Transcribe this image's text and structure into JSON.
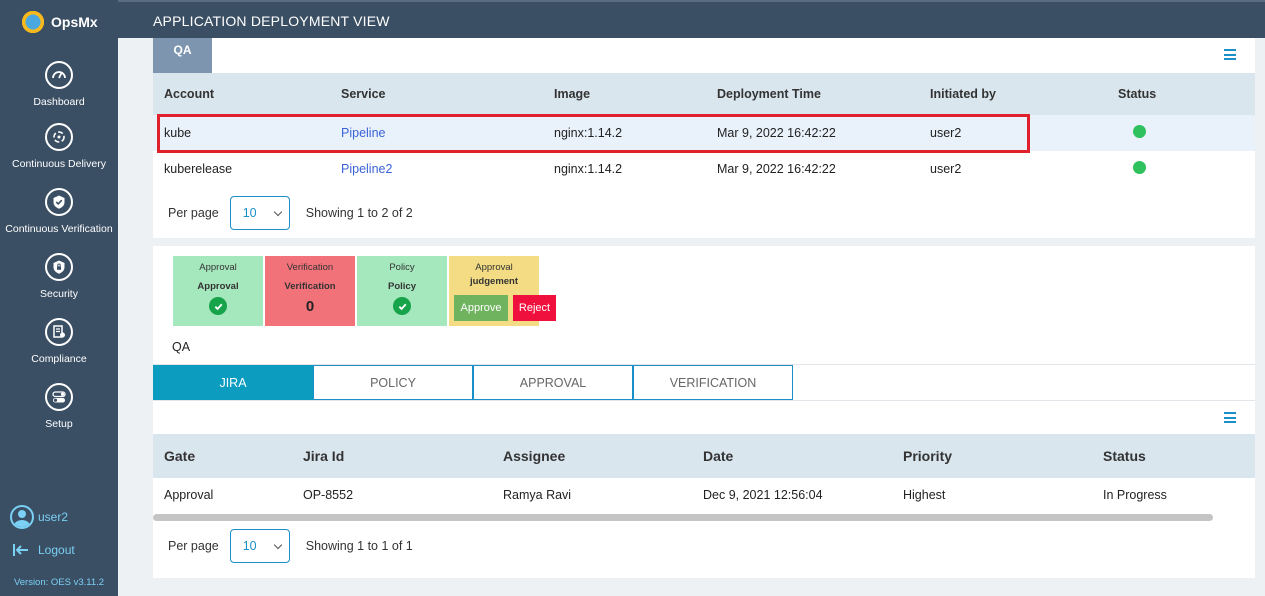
{
  "app": {
    "brand": "OpsMx",
    "page_title": "APPLICATION DEPLOYMENT VIEW"
  },
  "sidebar": {
    "items": [
      {
        "label": "Dashboard",
        "icon": "gauge-icon"
      },
      {
        "label": "Continuous Delivery",
        "icon": "delivery-cycle-icon"
      },
      {
        "label": "Continuous Verification",
        "icon": "verified-shield-icon"
      },
      {
        "label": "Security",
        "icon": "lock-shield-icon"
      },
      {
        "label": "Compliance",
        "icon": "compliance-doc-icon"
      },
      {
        "label": "Setup",
        "icon": "toggle-settings-icon"
      }
    ],
    "user": "user2",
    "logout": "Logout",
    "version": "Version: OES v3.11.2"
  },
  "deployments": {
    "env_tab": "QA",
    "columns": [
      "Account",
      "Service",
      "Image",
      "Deployment Time",
      "Initiated by",
      "Status"
    ],
    "rows": [
      {
        "account": "kube",
        "service": "Pipeline",
        "image": "nginx:1.14.2",
        "time": "Mar 9, 2022 16:42:22",
        "initiated_by": "user2",
        "status": "success"
      },
      {
        "account": "kuberelease",
        "service": "Pipeline2",
        "image": "nginx:1.14.2",
        "time": "Mar 9, 2022 16:42:22",
        "initiated_by": "user2",
        "status": "success"
      }
    ],
    "per_page_label": "Per page",
    "per_page_value": "10",
    "showing": "Showing 1 to 2 of 2"
  },
  "gates": {
    "cards": [
      {
        "type": "Approval",
        "name": "Approval",
        "color": "#a6e8bd"
      },
      {
        "type": "Verification",
        "name": "Verification",
        "score": "0",
        "color": "#f2727a"
      },
      {
        "type": "Policy",
        "name": "Policy",
        "color": "#a6e8bd"
      },
      {
        "type": "Approval",
        "name": "judgement",
        "color": "#f3dc84"
      }
    ],
    "approve_label": "Approve",
    "reject_label": "Reject",
    "stage_label": "QA"
  },
  "detail_tabs": [
    "JIRA",
    "POLICY",
    "APPROVAL",
    "VERIFICATION"
  ],
  "jira": {
    "columns": [
      "Gate",
      "Jira Id",
      "Assignee",
      "Date",
      "Priority",
      "Status"
    ],
    "rows": [
      {
        "gate": "Approval",
        "jira_id": "OP-8552",
        "assignee": "Ramya Ravi",
        "date": "Dec 9, 2021 12:56:04",
        "priority": "Highest",
        "status": "In Progress"
      }
    ],
    "per_page_label": "Per page",
    "per_page_value": "10",
    "showing": "Showing 1 to 1 of 1"
  },
  "colors": {
    "sidebar_bg": "#3b4f64",
    "accent": "#1a8fc8",
    "success": "#2ec15d",
    "highlight_border": "#e0202a"
  }
}
